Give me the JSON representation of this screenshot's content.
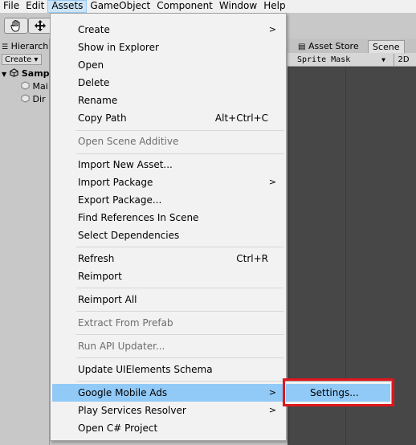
{
  "menubar": {
    "items": [
      "File",
      "Edit",
      "Assets",
      "GameObject",
      "Component",
      "Window",
      "Help"
    ]
  },
  "toolbar": {
    "tools": [
      "hand-tool-icon",
      "move-tool-icon"
    ]
  },
  "hierarchy": {
    "tab_label": "Hierarch",
    "create_label": "Create ▾",
    "scene_name": "Samp",
    "items": [
      "Mai",
      "Dir"
    ]
  },
  "scene": {
    "tabs": [
      "Asset Store",
      "Scene"
    ],
    "sprite_mask_label": "Sprite Mask",
    "mode_2d": "2D"
  },
  "assets_menu": {
    "items": [
      {
        "label": "Create",
        "submenu": true
      },
      {
        "label": "Show in Explorer"
      },
      {
        "label": "Open"
      },
      {
        "label": "Delete"
      },
      {
        "label": "Rename"
      },
      {
        "label": "Copy Path",
        "shortcut": "Alt+Ctrl+C"
      },
      {
        "label": "Open Scene Additive",
        "disabled": true
      },
      {
        "label": "Import New Asset..."
      },
      {
        "label": "Import Package",
        "submenu": true
      },
      {
        "label": "Export Package..."
      },
      {
        "label": "Find References In Scene"
      },
      {
        "label": "Select Dependencies"
      },
      {
        "label": "Refresh",
        "shortcut": "Ctrl+R"
      },
      {
        "label": "Reimport"
      },
      {
        "label": "Reimport All"
      },
      {
        "label": "Extract From Prefab",
        "disabled": true
      },
      {
        "label": "Run API Updater...",
        "disabled": true
      },
      {
        "label": "Update UIElements Schema"
      },
      {
        "label": "Google Mobile Ads",
        "submenu": true,
        "highlighted": true
      },
      {
        "label": "Play Services Resolver",
        "submenu": true
      },
      {
        "label": "Open C# Project"
      }
    ]
  },
  "submenu": {
    "settings_label": "Settings..."
  },
  "colors": {
    "highlight": "#91c9f7",
    "callout": "#e0161d",
    "scene_background": "#474747"
  }
}
